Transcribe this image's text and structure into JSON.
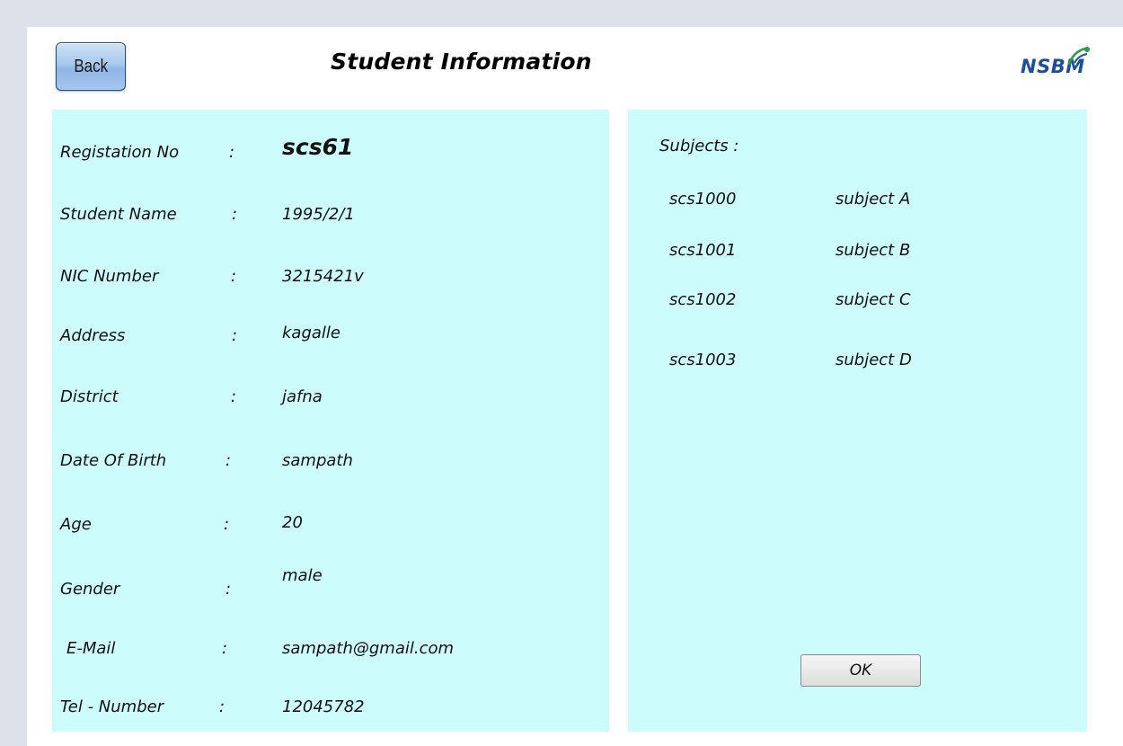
{
  "header": {
    "back_label": "Back",
    "title": "Student Information",
    "logo_text": "NSBM"
  },
  "student": {
    "fields": [
      {
        "label": "Registation No",
        "value": "scs61"
      },
      {
        "label": "Student Name",
        "value": "1995/2/1"
      },
      {
        "label": "NIC Number",
        "value": "3215421v"
      },
      {
        "label": "Address",
        "value": "kagalle"
      },
      {
        "label": "District",
        "value": "jafna"
      },
      {
        "label": "Date Of Birth",
        "value": "sampath"
      },
      {
        "label": "Age",
        "value": "20"
      },
      {
        "label": "Gender",
        "value": "male"
      },
      {
        "label": "E-Mail",
        "value": "sampath@gmail.com"
      },
      {
        "label": "Tel - Number",
        "value": "12045782"
      }
    ],
    "separator": ":"
  },
  "subjects": {
    "label": "Subjects  :",
    "items": [
      {
        "code": "scs1000",
        "name": "subject A"
      },
      {
        "code": "scs1001",
        "name": "subject B"
      },
      {
        "code": "scs1002",
        "name": "subject C"
      },
      {
        "code": "scs1003",
        "name": "subject D"
      }
    ],
    "ok_label": "OK"
  },
  "colors": {
    "panel_bg": "#ccfdfc",
    "page_bg": "#dde2ea",
    "logo_blue": "#1d4e9c"
  }
}
